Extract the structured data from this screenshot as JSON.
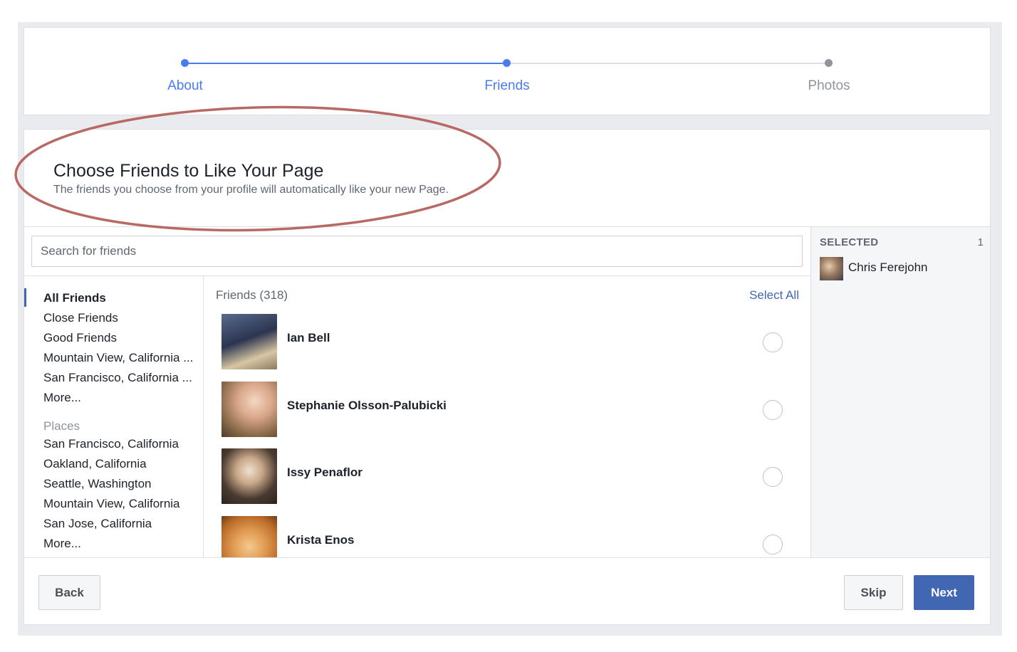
{
  "stepper": {
    "steps": [
      {
        "label": "About",
        "state": "complete"
      },
      {
        "label": "Friends",
        "state": "current"
      },
      {
        "label": "Photos",
        "state": "upcoming"
      }
    ]
  },
  "header": {
    "title": "Choose Friends to Like Your Page",
    "subtitle": "The friends you choose from your profile will automatically like your new Page."
  },
  "search": {
    "placeholder": "Search for friends",
    "value": ""
  },
  "sidebar": {
    "lists": [
      {
        "label": "All Friends",
        "active": true
      },
      {
        "label": "Close Friends"
      },
      {
        "label": "Good Friends"
      },
      {
        "label": "Mountain View, California ..."
      },
      {
        "label": "San Francisco, California ..."
      },
      {
        "label": "More..."
      }
    ],
    "places_heading": "Places",
    "places": [
      {
        "label": "San Francisco, California"
      },
      {
        "label": "Oakland, California"
      },
      {
        "label": "Seattle, Washington"
      },
      {
        "label": "Mountain View, California"
      },
      {
        "label": "San Jose, California"
      },
      {
        "label": "More..."
      }
    ]
  },
  "friends": {
    "count_label": "Friends (318)",
    "select_all_label": "Select All",
    "items": [
      {
        "name": "Ian Bell",
        "selected": false
      },
      {
        "name": "Stephanie Olsson-Palubicki",
        "selected": false
      },
      {
        "name": "Issy Penaflor",
        "selected": false
      },
      {
        "name": "Krista Enos",
        "selected": false
      }
    ]
  },
  "selected_panel": {
    "heading": "SELECTED",
    "count": "1",
    "items": [
      {
        "name": "Chris Ferejohn"
      }
    ]
  },
  "footer": {
    "back_label": "Back",
    "skip_label": "Skip",
    "next_label": "Next"
  },
  "colors": {
    "accent": "#4a7cf0",
    "primary_button": "#4267b2",
    "annotation": "#b5615c"
  }
}
